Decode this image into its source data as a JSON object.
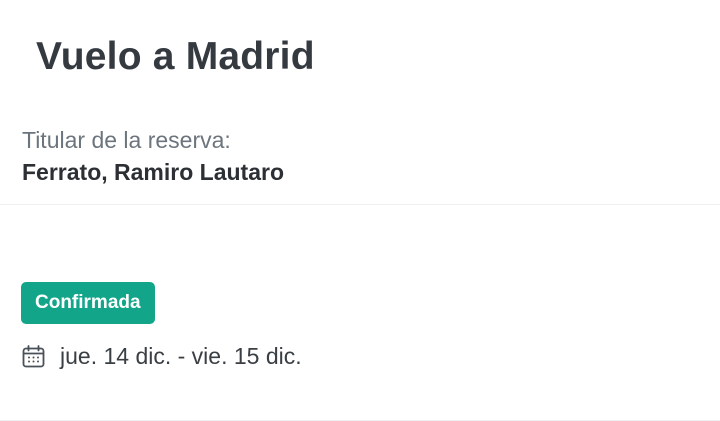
{
  "booking": {
    "title": "Vuelo a Madrid",
    "holder_label": "Titular de la reserva:",
    "holder_name": "Ferrato, Ramiro Lautaro",
    "status": "Confirmada",
    "dates": "jue. 14 dic. - vie. 15 dic."
  },
  "icons": {
    "calendar": "calendar-icon"
  },
  "colors": {
    "status_badge": "#12a589",
    "title": "#343a40",
    "label": "#6c757d"
  }
}
